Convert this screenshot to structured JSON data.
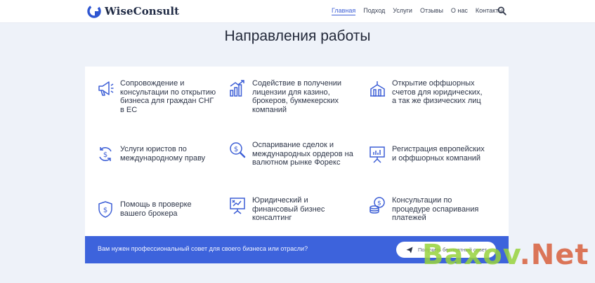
{
  "header": {
    "brand": "WiseConsult",
    "nav": [
      "Главная",
      "Подход",
      "Услуги",
      "Отзывы",
      "О нас",
      "Контакты"
    ],
    "active_nav": "Главная"
  },
  "page": {
    "title": "Направления работы"
  },
  "services": [
    {
      "label": "Сопровождение и консультации по открытию бизнеса для граждан СНГ в ЕС",
      "icon": "megaphone-icon"
    },
    {
      "label": "Содействие в получении лицензии для казино, брокеров, букмекерских компаний",
      "icon": "growth-chart-icon"
    },
    {
      "label": "Открытие оффшорных счетов для юридических, а так же физических лиц",
      "icon": "bank-building-icon"
    },
    {
      "label": "Услуги юристов по международному праву",
      "icon": "dollar-exchange-icon"
    },
    {
      "label": "Оспаривание сделок и международных ордеров на валютном рынке Форекс",
      "icon": "dollar-search-icon"
    },
    {
      "label": "Регистрация европейских и оффшорных компаний",
      "icon": "presentation-board-icon"
    },
    {
      "label": "Помощь в проверке вашего брокера",
      "icon": "dollar-shield-icon"
    },
    {
      "label": "Юридический и финансовый бизнес консалтинг",
      "icon": "strategy-board-icon"
    },
    {
      "label": "Консультации по процедуре оспаривания платежей",
      "icon": "coins-dollar-icon"
    }
  ],
  "cta": {
    "text": "Вам нужен профессиональный совет для своего бизнеса или отрасли?",
    "button": "Получить бесплатный совет"
  },
  "watermark": {
    "part1": "Baxov",
    "part2": ".Net"
  },
  "colors": {
    "accent": "#3d63dc",
    "icon": "#3d5fd6",
    "background": "#eef2f9"
  }
}
